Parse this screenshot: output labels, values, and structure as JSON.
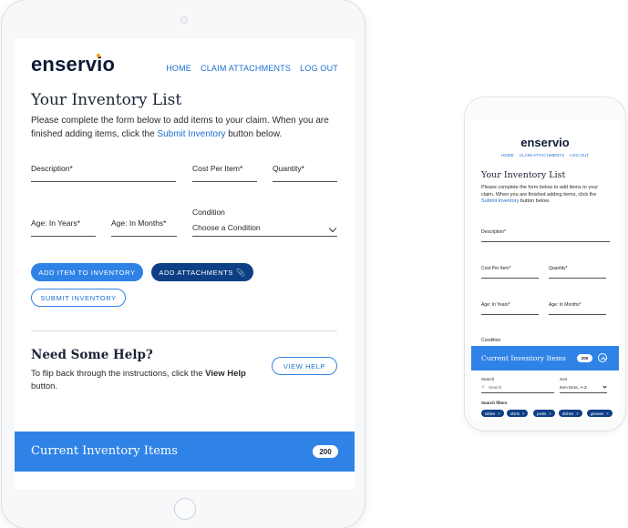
{
  "brand": {
    "name": "enservio"
  },
  "nav": {
    "home": "HOME",
    "claim_attachments": "CLAIM ATTACHMENTS",
    "logout": "LOG OUT"
  },
  "inventory": {
    "title": "Your Inventory List",
    "intro_before": "Please complete the form below to add items to your claim. When you are finished adding items, click the ",
    "intro_link": "Submit Inventory",
    "intro_after": " button below."
  },
  "fields": {
    "description": "Description*",
    "cost": "Cost Per Item*",
    "quantity": "Quantity*",
    "age_years": "Age: In Years*",
    "age_months": "Age: In Months*",
    "condition": "Condition",
    "condition_value": "Choose a Condition"
  },
  "buttons": {
    "add_item": "ADD ITEM TO INVENTORY",
    "add_attachments": "ADD ATTACHMENTS",
    "submit": "SUBMIT INVENTORY",
    "view_help": "VIEW HELP"
  },
  "help": {
    "title": "Need Some Help?",
    "text_before": "To flip back through the instructions, click the ",
    "text_bold": "View Help",
    "text_after": " button."
  },
  "current_items": {
    "title": "Current Inventory Items",
    "count": "200"
  },
  "phone": {
    "search_label": "Search",
    "search_placeholder": "Search",
    "sort_label": "Sort",
    "sort_value": "Item Desc, A-Z",
    "filters_label": "Search filters",
    "chips": [
      "tables",
      "shirts",
      "pants",
      "dishes",
      "glasses"
    ]
  },
  "colors": {
    "accent": "#2f83e6",
    "navy": "#0e3f86",
    "link": "#1c6fd1"
  }
}
